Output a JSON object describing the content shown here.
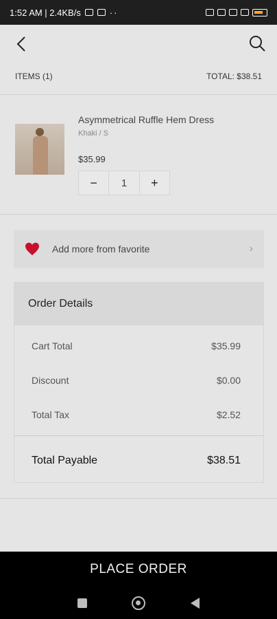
{
  "status_bar": {
    "time_speed": "1:52 AM | 2.4KB/s",
    "dots": "··"
  },
  "header": {
    "items_label": "ITEMS (1)",
    "total_label": "TOTAL: $38.51"
  },
  "cart_item": {
    "name": "Asymmetrical Ruffle Hem Dress",
    "variant": "Khaki / S",
    "price": "$35.99",
    "quantity": "1",
    "minus": "−",
    "plus": "+"
  },
  "favorites": {
    "label": "Add more from favorite",
    "chevron": "›"
  },
  "order_details": {
    "title": "Order Details",
    "rows": [
      {
        "label": "Cart Total",
        "value": "$35.99"
      },
      {
        "label": "Discount",
        "value": "$0.00"
      },
      {
        "label": "Total Tax",
        "value": "$2.52"
      }
    ],
    "total_label": "Total Payable",
    "total_value": "$38.51"
  },
  "place_order_label": "PLACE ORDER",
  "colors": {
    "accent_heart": "#c8102e",
    "button_bg": "#000000"
  }
}
